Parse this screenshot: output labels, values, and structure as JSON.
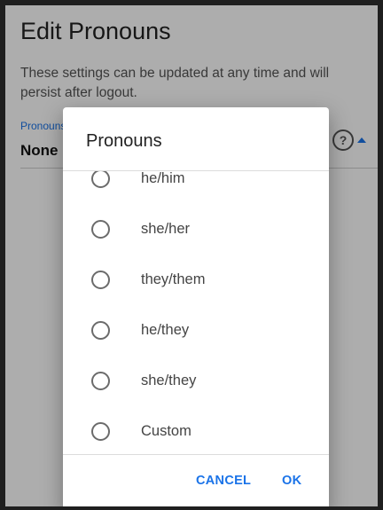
{
  "screen": {
    "title": "Edit Pronouns",
    "description": "These settings can be updated at any time and will persist after logout.",
    "field": {
      "label": "Pronouns",
      "value": "None",
      "help_glyph": "?"
    }
  },
  "dialog": {
    "title": "Pronouns",
    "options": [
      "he/him",
      "she/her",
      "they/them",
      "he/they",
      "she/they",
      "Custom"
    ],
    "cancel_label": "CANCEL",
    "ok_label": "OK"
  },
  "colors": {
    "accent": "#1a73e8",
    "scrim": "rgba(0,0,0,0.32)"
  },
  "icons": [
    "help-icon",
    "arrow-up-icon",
    "radio-unchecked-icon"
  ]
}
